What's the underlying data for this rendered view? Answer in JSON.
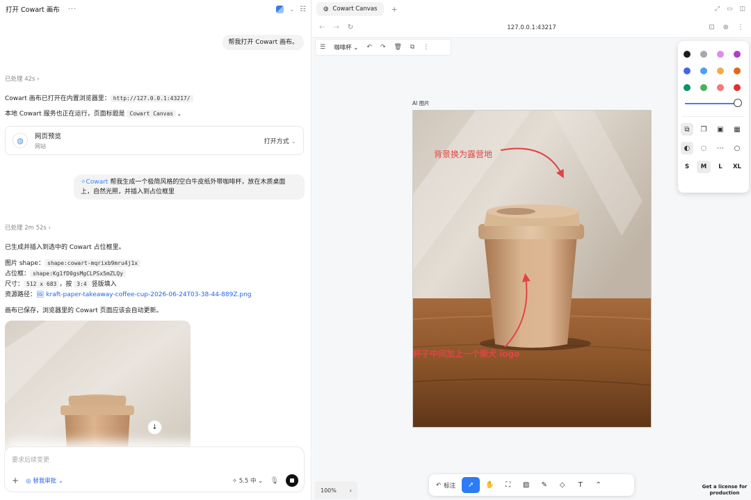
{
  "left": {
    "title": "打开 Cowart 画布",
    "more": "···",
    "msg1": "帮我打开 Cowart 画布。",
    "processed1": "已处理 42s",
    "l1_pre": "Cowart 画布已打开在内置浏览器里：",
    "l1_code": "http://127.0.0.1:43217/",
    "l2_pre": "本地 Cowart 服务也正在运行，页面标题是 ",
    "l2_code": "Cowart Canvas",
    "l2_post": " 。",
    "preview_title": "网页预览",
    "preview_sub": "网站",
    "preview_open": "打开方式",
    "msg2_tag": "Cowart",
    "msg2": " 帮我生成一个极简风格的空白牛皮纸外带咖啡杯，放在木质桌面上，自然光照，并插入到占位框里",
    "processed2": "已处理 2m 52s",
    "r1": "已生成并插入到选中的 Cowart 占位框里。",
    "r2_pre": "图片 shape：",
    "r2_code": "shape:cowart-mqrixb9mru4j1x",
    "r3_pre": "占位框：",
    "r3_code": "shape:Kg1fD0gsMgCLPSx5mZLQy",
    "r4_pre": "尺寸：",
    "r4_code1": "512 x 683",
    "r4_mid": "，按 ",
    "r4_code2": "3:4",
    "r4_post": " 竖版填入",
    "r5_pre": "资源路径：",
    "r5_link": "kraft-paper-takeaway-coffee-cup-2026-06-24T03-38-44-889Z.png",
    "r6": "画布已保存，浏览器里的 Cowart 页面应该会自动更新。",
    "composer_placeholder": "要求后续变更",
    "approve": "替我审批",
    "model": "5.5 中"
  },
  "browser": {
    "tab_title": "Cowart Canvas",
    "url": "127.0.0.1:43217",
    "page_name": "咖啡杯",
    "frame_label": "AI 图片",
    "annotation_top": "背景换为露营地",
    "annotation_bottom": "杯子中间加上一个柴犬 logo",
    "zoom": "100%",
    "tool_annotate": "标注",
    "license": "Get a license for production",
    "sizes": [
      "S",
      "M",
      "L",
      "XL"
    ],
    "colors": [
      "#1d1d1d",
      "#a8a8a8",
      "#de8bee",
      "#ae3ec9",
      "#4465e9",
      "#4ba1f1",
      "#f1ac4b",
      "#e16919",
      "#099268",
      "#4cb05e",
      "#f87777",
      "#e03131"
    ],
    "accent": "#2b7cf6"
  }
}
